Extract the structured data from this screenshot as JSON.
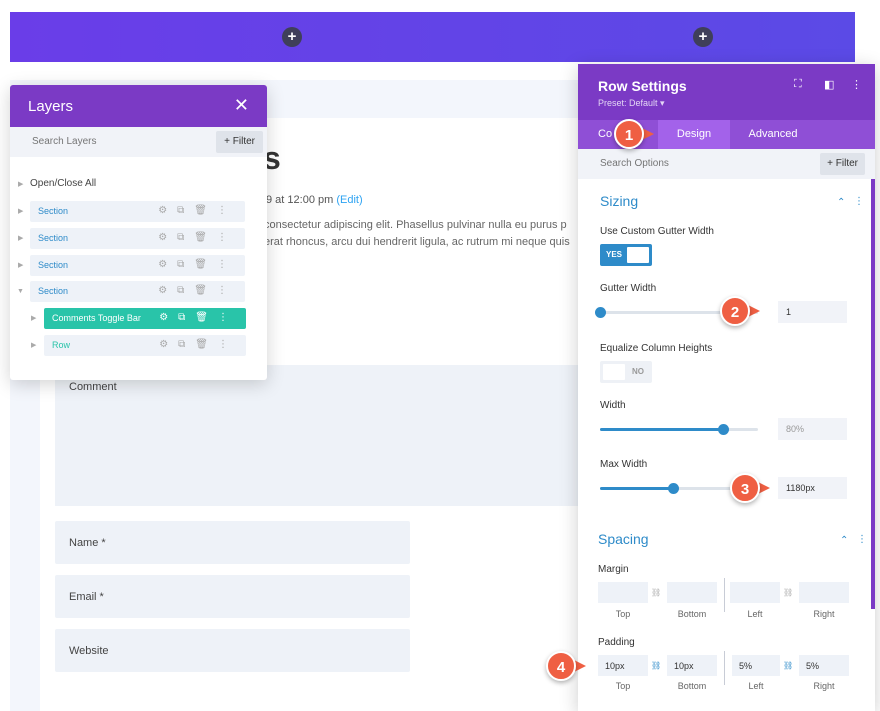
{
  "background": {
    "heading_fragment": "s",
    "meta_fragment": "9 at 12:00 pm",
    "edit_link": "(Edit)",
    "body_line1": "consectetur adipiscing elit. Phasellus pulvinar nulla eu purus p",
    "body_line2": "erat rhoncus, arcu dui hendrerit ligula, ac rutrum mi neque quis",
    "comment_label": "Comment",
    "name_label": "Name *",
    "email_label": "Email *",
    "website_label": "Website",
    "colors": {
      "top_bar": "#6a3de8",
      "page_bg": "#f3f6fc"
    }
  },
  "layers": {
    "title": "Layers",
    "close_icon": "close-icon",
    "search_placeholder": "Search Layers",
    "filter_label": "+ Filter",
    "open_close": "Open/Close All",
    "items": [
      {
        "label": "Section"
      },
      {
        "label": "Section"
      },
      {
        "label": "Section"
      },
      {
        "label": "Section"
      },
      {
        "label": "Comments Toggle Bar"
      },
      {
        "label": "Row"
      }
    ],
    "colors": {
      "header": "#7b3ac5",
      "active": "#29c4a9"
    }
  },
  "settings": {
    "title": "Row Settings",
    "preset": "Preset: Default ▾",
    "tabs": [
      "Co",
      "Design",
      "Advanced"
    ],
    "search_placeholder": "Search Options",
    "filter_label": "+ Filter",
    "sizing": {
      "title": "Sizing",
      "custom_gutter_label": "Use Custom Gutter Width",
      "custom_gutter_value": "YES",
      "gutter_width_label": "Gutter Width",
      "gutter_width_value": "1",
      "gutter_width_level": 0,
      "equalize_label": "Equalize Column Heights",
      "equalize_value": "NO",
      "width_label": "Width",
      "width_value": "80%",
      "width_level": 0.78,
      "max_width_label": "Max Width",
      "max_width_value": "1180px",
      "max_width_level": 0.46
    },
    "spacing": {
      "title": "Spacing",
      "margin_label": "Margin",
      "padding_label": "Padding",
      "sub_labels": [
        "Top",
        "Bottom",
        "Left",
        "Right"
      ],
      "padding_values": [
        "10px",
        "10px",
        "5%",
        "5%"
      ]
    },
    "colors": {
      "header": "#7b3ac5",
      "accent": "#2e8bc9",
      "badge": "#ef5f43"
    }
  },
  "callouts": [
    "1",
    "2",
    "3",
    "4"
  ]
}
